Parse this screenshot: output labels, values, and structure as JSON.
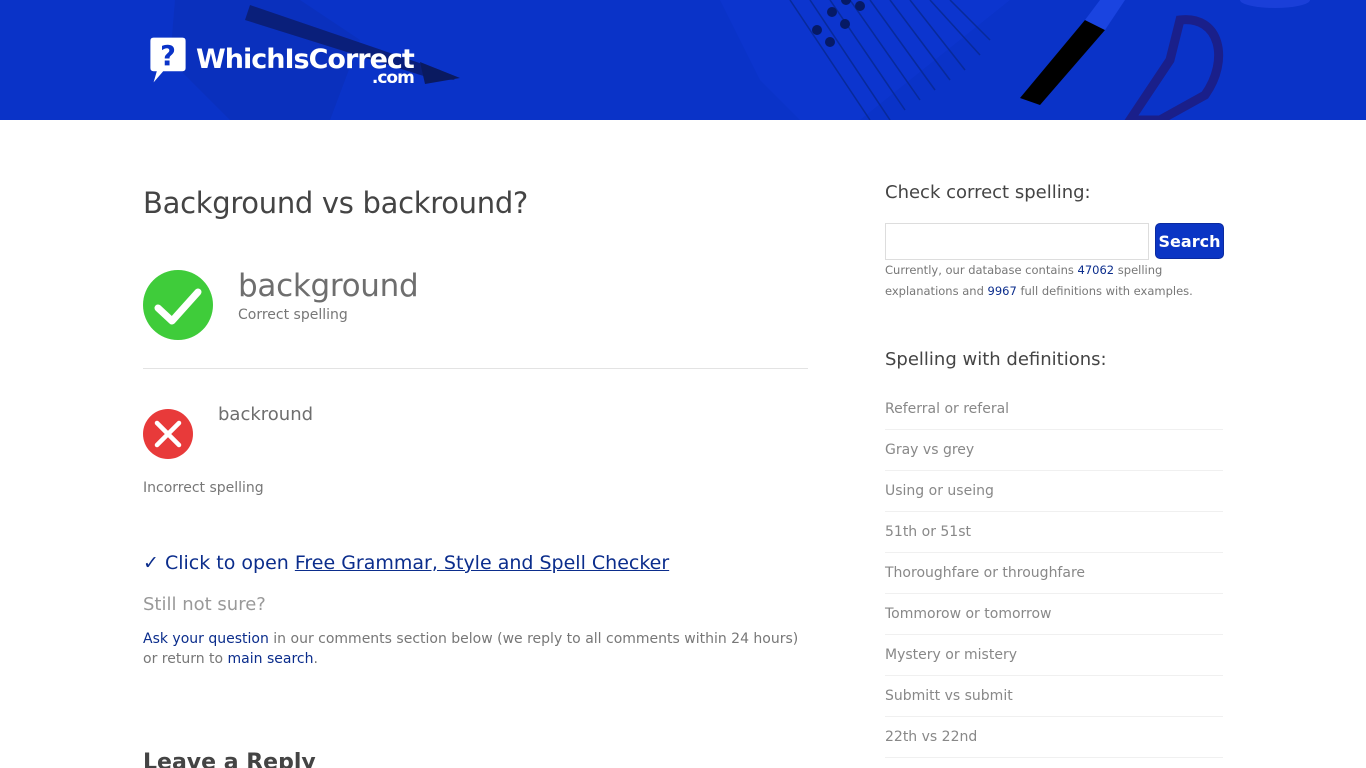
{
  "site": {
    "logo_main": "WhichIsCorrect",
    "logo_sub": ".com",
    "brand_color": "#0a33c8"
  },
  "main": {
    "title": "Background vs backround?",
    "correct": {
      "word": "background",
      "label": "Correct spelling",
      "icon": "check-circle-icon",
      "color": "#3fcc3a"
    },
    "incorrect": {
      "word": "backround",
      "label": "Incorrect spelling",
      "icon": "x-circle-icon",
      "color": "#e83a3a"
    },
    "checker": {
      "prefix": "✓ Click to open ",
      "link": "Free Grammar, Style and Spell Checker"
    },
    "still_not_sure": "Still not sure?",
    "ask": {
      "link1": "Ask your question",
      "middle": " in our comments section below (we reply to all comments within 24 hours) or return to ",
      "link2": "main search",
      "end": "."
    },
    "reply_title": "Leave a Reply"
  },
  "sidebar": {
    "check_title": "Check correct spelling:",
    "search": {
      "value": "",
      "placeholder": "",
      "button": "Search"
    },
    "db_info": {
      "prefix": "Currently, our database contains ",
      "explanations": "47062",
      "middle": " spelling explanations and ",
      "definitions": "9967",
      "suffix": " full definitions with examples."
    },
    "definitions_title": "Spelling with definitions:",
    "definitions": [
      "Referral or referal",
      "Gray vs grey",
      "Using or useing",
      "51th or 51st",
      "Thoroughfare or throughfare",
      "Tommorow or tomorrow",
      "Mystery or mistery",
      "Submitt vs submit",
      "22th vs 22nd"
    ]
  }
}
